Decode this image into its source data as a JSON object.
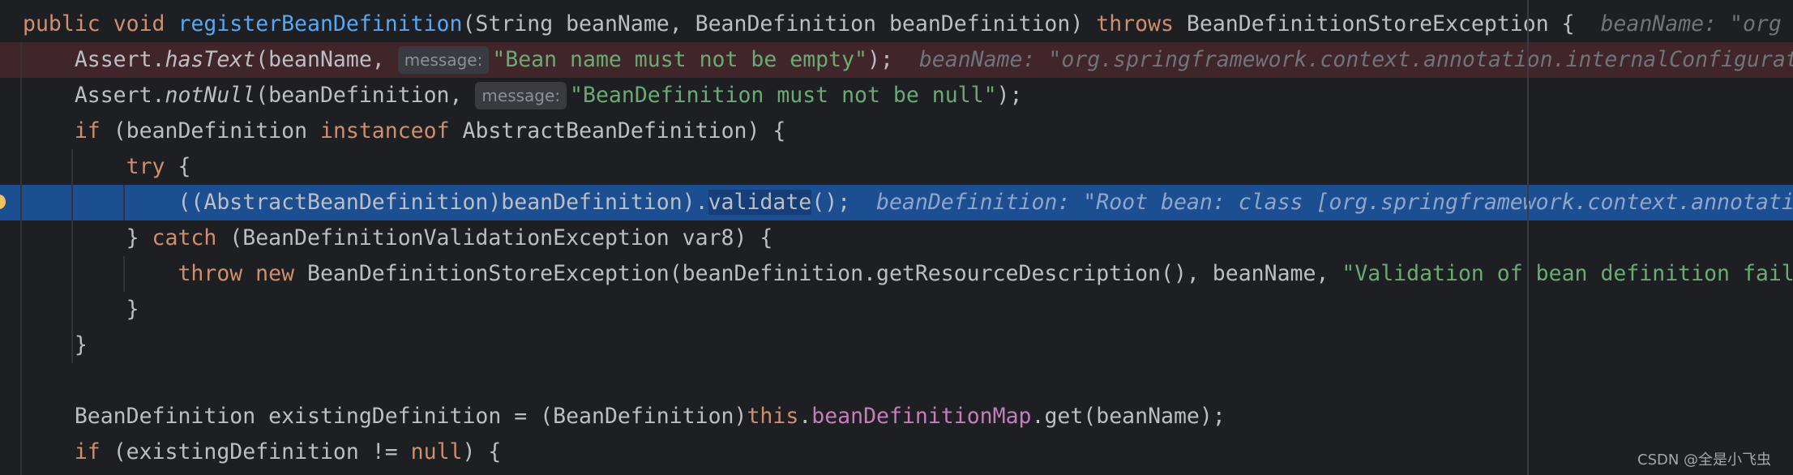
{
  "editor": {
    "lines": [
      {
        "state": "normal",
        "tokens": [
          [
            "public ",
            "kw"
          ],
          [
            "void ",
            "kw"
          ],
          [
            "registerBeanDefinition",
            "fn"
          ],
          [
            "(String beanName, BeanDefinition beanDefinition) ",
            ""
          ],
          [
            "throws ",
            "kw"
          ],
          [
            "BeanDefinitionStoreException {  ",
            ""
          ],
          [
            "beanName: \"org",
            "hint"
          ]
        ]
      },
      {
        "state": "error",
        "tokens": [
          [
            "    Assert.",
            ""
          ],
          [
            "hasText",
            "it"
          ],
          [
            "(beanName, ",
            ""
          ],
          [
            "message:",
            "inlay"
          ],
          [
            "\"Bean name must not be empty\"",
            "str"
          ],
          [
            ");  ",
            ""
          ],
          [
            "beanName: \"org.springframework.context.annotation.internalConfigurationAnnotationProcessor\"",
            "hint"
          ]
        ]
      },
      {
        "state": "normal",
        "tokens": [
          [
            "    Assert.",
            ""
          ],
          [
            "notNull",
            "it"
          ],
          [
            "(beanDefinition, ",
            ""
          ],
          [
            "message:",
            "inlay"
          ],
          [
            "\"BeanDefinition must not be null\"",
            "str"
          ],
          [
            ");",
            ""
          ]
        ]
      },
      {
        "state": "normal",
        "tokens": [
          [
            "    ",
            ""
          ],
          [
            "if ",
            "kw"
          ],
          [
            "(beanDefinition ",
            ""
          ],
          [
            "instanceof ",
            "kw"
          ],
          [
            "AbstractBeanDefinition) {",
            ""
          ]
        ]
      },
      {
        "state": "normal",
        "tokens": [
          [
            "        ",
            ""
          ],
          [
            "try ",
            "kw"
          ],
          [
            "{",
            ""
          ]
        ]
      },
      {
        "state": "exec",
        "tokens": [
          [
            "            ((AbstractBeanDefinition)beanDefinition).",
            ""
          ],
          [
            "validate",
            "hl"
          ],
          [
            "();  ",
            ""
          ],
          [
            "beanDefinition: \"Root bean: class [org.springframework.context.annotation.ConfigurationClassPostProcessor]\"",
            "hint"
          ]
        ]
      },
      {
        "state": "normal",
        "tokens": [
          [
            "        } ",
            ""
          ],
          [
            "catch ",
            "kw"
          ],
          [
            "(BeanDefinitionValidationException var8) {",
            ""
          ]
        ]
      },
      {
        "state": "normal",
        "tokens": [
          [
            "            ",
            ""
          ],
          [
            "throw new ",
            "kw"
          ],
          [
            "BeanDefinitionStoreException(beanDefinition.getResourceDescription(), beanName, ",
            ""
          ],
          [
            "\"Validation of bean definition failed\"",
            "str"
          ]
        ]
      },
      {
        "state": "normal",
        "tokens": [
          [
            "        }",
            ""
          ]
        ]
      },
      {
        "state": "normal",
        "tokens": [
          [
            "    }",
            ""
          ]
        ]
      },
      {
        "state": "normal",
        "tokens": []
      },
      {
        "state": "normal",
        "tokens": [
          [
            "    BeanDefinition existingDefinition = (BeanDefinition)",
            ""
          ],
          [
            "this",
            "kw"
          ],
          [
            ".",
            ""
          ],
          [
            "beanDefinitionMap",
            "field"
          ],
          [
            ".get(beanName);",
            ""
          ]
        ]
      },
      {
        "state": "normal",
        "tokens": [
          [
            "    ",
            ""
          ],
          [
            "if ",
            "kw"
          ],
          [
            "(existingDefinition != ",
            ""
          ],
          [
            "null",
            "kw"
          ],
          [
            ") {",
            ""
          ]
        ]
      }
    ]
  },
  "colors": {
    "background": "#1e1f22",
    "keyword": "#cf8e6d",
    "method_declaration": "#56a8f5",
    "string": "#6aab73",
    "field": "#c77dbb",
    "error_line": "#40252b",
    "execution_line": "#1c4f92",
    "breakpoint": "#f2c55c"
  },
  "watermark": "CSDN @全是小飞虫"
}
